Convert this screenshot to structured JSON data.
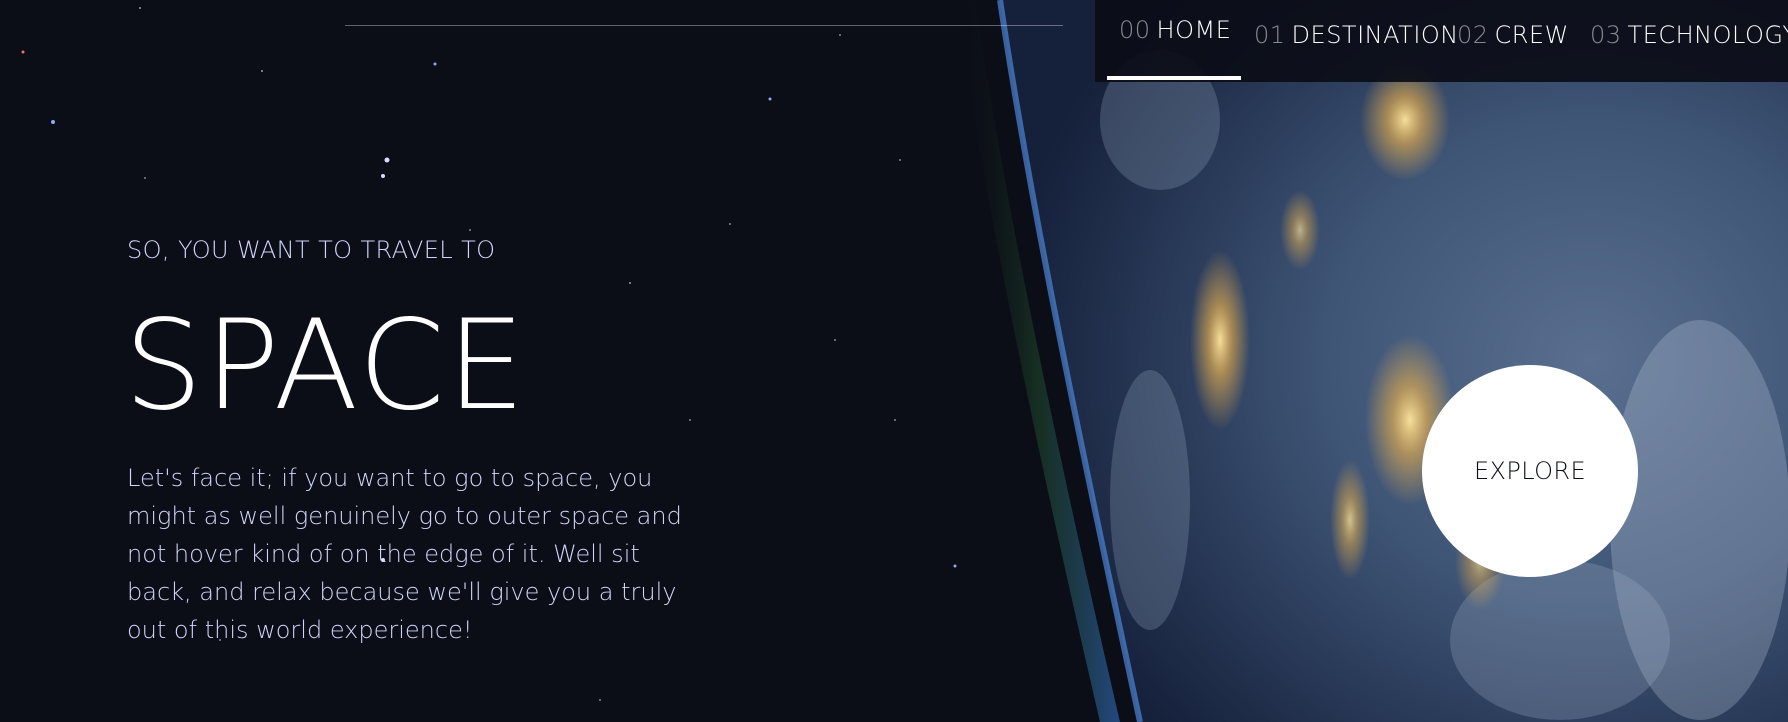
{
  "nav": {
    "items": [
      {
        "num": "00",
        "label": "HOME",
        "active": true
      },
      {
        "num": "01",
        "label": "DESTINATION",
        "active": false
      },
      {
        "num": "02",
        "label": "CREW",
        "active": false
      },
      {
        "num": "03",
        "label": "TECHNOLOGY",
        "active": false
      }
    ]
  },
  "hero": {
    "subtitle": "SO, YOU WANT TO TRAVEL TO",
    "title": "SPACE",
    "body": "Let's face it; if you want to go to space, you might as well genuinely go to outer space and not hover kind of on the edge of it. Well sit back, and relax because we'll give you a truly out of this world experience!"
  },
  "cta": {
    "label": "EXPLORE"
  },
  "colors": {
    "background": "#0b0d17",
    "text_primary": "#ffffff",
    "text_secondary": "#d0d6f9",
    "button_bg": "#ffffff"
  },
  "background_image": "earth-from-space"
}
